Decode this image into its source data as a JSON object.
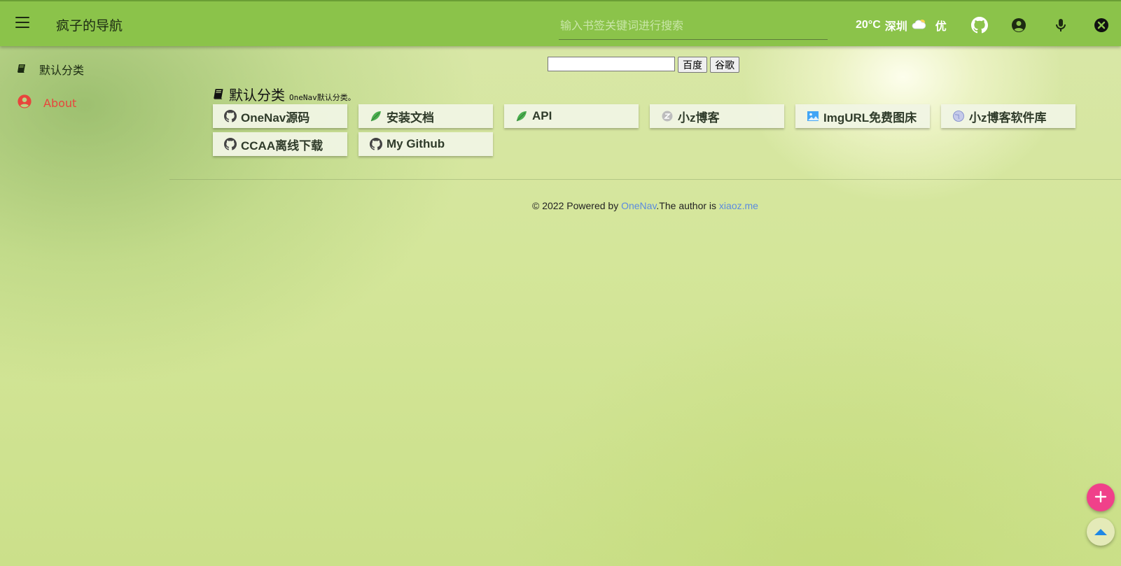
{
  "header": {
    "title": "疯子的导航",
    "search_placeholder": "输入书签关键词进行搜索",
    "weather": {
      "temp": "20°C",
      "city": "深圳",
      "icon": "cloud-sun-icon",
      "air": "优"
    }
  },
  "sidebar": {
    "items": [
      {
        "label": "默认分类",
        "icon": "book-icon",
        "color": "#1b2a12"
      },
      {
        "label": "About",
        "icon": "user-circle-icon",
        "color": "#e8453c"
      }
    ]
  },
  "engine": {
    "value": "",
    "buttons": [
      "百度",
      "谷歌"
    ]
  },
  "category": {
    "name": "默认分类",
    "desc": "OneNav默认分类。"
  },
  "links": [
    {
      "label": "OneNav源码",
      "icon": "github-icon"
    },
    {
      "label": "安装文档",
      "icon": "leaf-icon"
    },
    {
      "label": "API",
      "icon": "leaf-icon"
    },
    {
      "label": "小z博客",
      "icon": "z-logo-icon"
    },
    {
      "label": "ImgURL免费图床",
      "icon": "image-icon"
    },
    {
      "label": "小z博客软件库",
      "icon": "globe-icon"
    },
    {
      "label": "CCAA离线下载",
      "icon": "github-icon"
    },
    {
      "label": "My Github",
      "icon": "github-icon"
    }
  ],
  "footer": {
    "prefix": "© 2022 Powered by ",
    "link1": "OneNav",
    "middle": ".The author is ",
    "link2": "xiaoz.me"
  },
  "colors": {
    "header": "#8bc34a",
    "accent": "#f0418a",
    "link": "#5b8be0",
    "about": "#e8453c"
  }
}
